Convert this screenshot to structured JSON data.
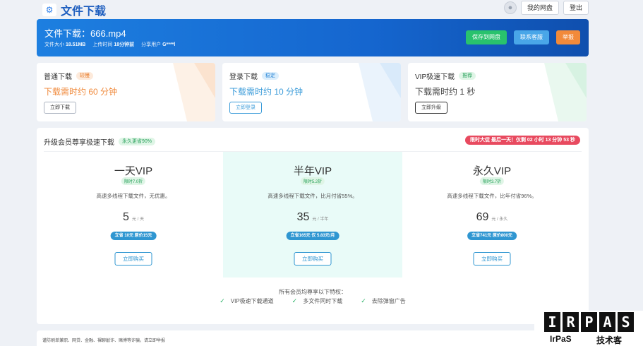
{
  "header": {
    "logo_icon": "gear-icon",
    "title": "文件下载",
    "my_drive": "我的网盘",
    "logout": "登出"
  },
  "banner": {
    "title": "文件下载：666.mp4",
    "size_label": "文件大小",
    "size_value": "18.51MB",
    "upload_label": "上传时间",
    "upload_value": "18分钟前",
    "sharer_label": "分享用户",
    "sharer_value": "G****l",
    "save_button": "保存到网盘",
    "service_button": "联系客服",
    "report_button": "举报",
    "colors": {
      "green": "#29c26d",
      "blue": "#49a6e8",
      "orange": "#f28a3a"
    }
  },
  "download_options": [
    {
      "title": "普通下载",
      "tag": "较慢",
      "time": "下载需时约 60 分钟",
      "button": "立即下载",
      "color": "#f08a3c"
    },
    {
      "title": "登录下载",
      "tag": "稳定",
      "time": "下载需时约 10 分钟",
      "button": "立即登录",
      "color": "#3a9bd9"
    },
    {
      "title": "VIP极速下载",
      "tag": "推荐",
      "time": "下载需时约 1 秒",
      "button": "立即升级",
      "color": "#444444"
    }
  ],
  "vip": {
    "title": "升级会员尊享极速下载",
    "title_tag": "永久更省90%",
    "countdown": "限时大促 最后一天！仅剩 02 小时 13 分钟 53 秒",
    "plans": [
      {
        "name": "一天VIP",
        "tag": "限时7.0折",
        "desc": "高速多线程下载文件，无优惠。",
        "price": "5",
        "unit": "元 / 天",
        "save": "立省 10元 原价15元",
        "button": "立即购买",
        "highlight": false
      },
      {
        "name": "半年VIP",
        "tag": "限时5.2折",
        "desc": "高速多线程下载文件，比月付省55%。",
        "price": "35",
        "unit": "元 / 半年",
        "save": "立省165元 仅 5.83元/月",
        "button": "立即购买",
        "highlight": true
      },
      {
        "name": "永久VIP",
        "tag": "限时3.7折",
        "desc": "高速多线程下载文件，比年付省96%。",
        "price": "69",
        "unit": "元 / 永久",
        "save": "立省741元 原价800元",
        "button": "立即购买",
        "highlight": false
      }
    ],
    "perks_title": "所有会员均尊享以下特权：",
    "perks": [
      "VIP极速下载通道",
      "多文件同时下载",
      "去除弹窗广告"
    ]
  },
  "footer": {
    "text": "谨防刷单兼职、网贷、金融、裸聊敲诈、赌博等诈骗，请立即举报"
  },
  "watermark": {
    "letters": [
      "I",
      "R",
      "P",
      "A",
      "S"
    ],
    "left_text": "IrPaS",
    "right_text": "技术客"
  }
}
